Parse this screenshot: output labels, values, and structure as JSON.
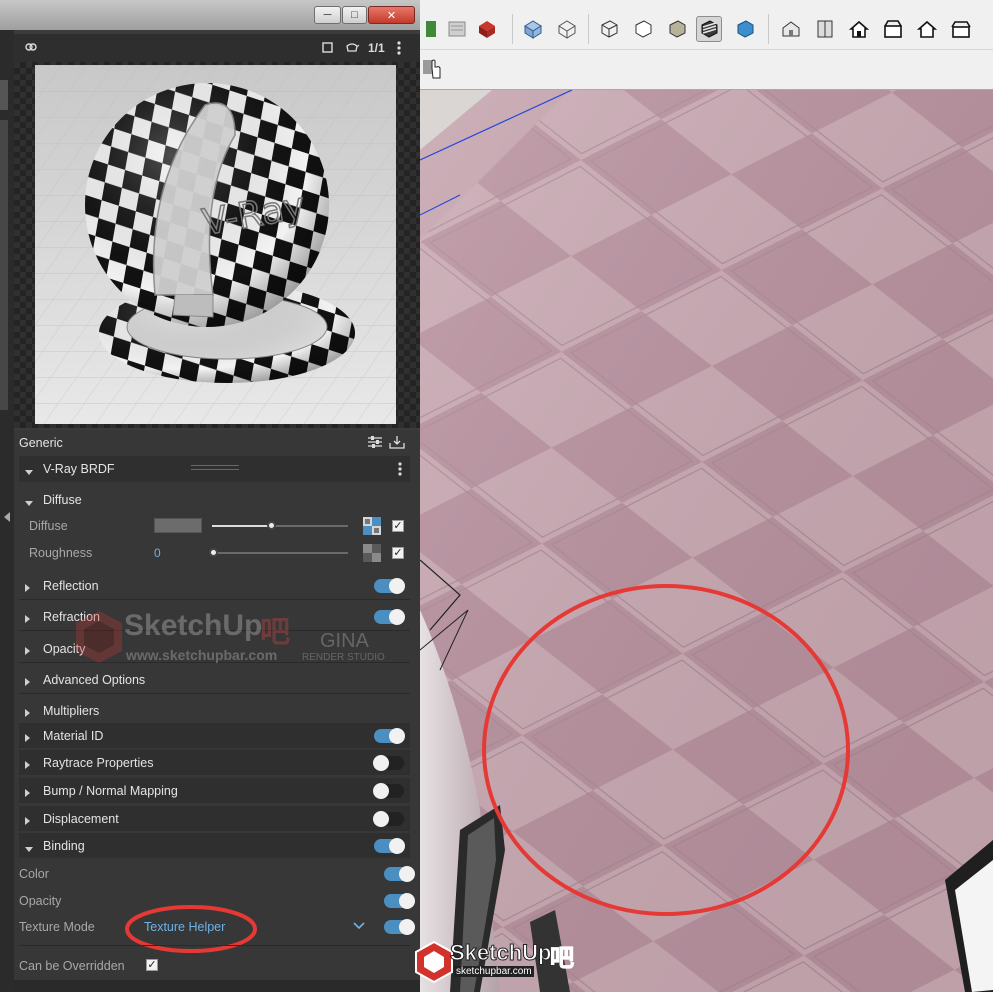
{
  "window": {
    "minimize_glyph": "─",
    "maximize_glyph": "□",
    "close_glyph": "✕"
  },
  "preview": {
    "icons": [
      "link-icon",
      "stop-icon",
      "teapot-icon",
      "aspect-icon",
      "more-icon"
    ],
    "aspect_label": "1/1",
    "ball_logo_text": "V-Ray"
  },
  "material": {
    "header_label": "Generic",
    "brdf_label": "V-Ray BRDF",
    "diffuse_section": "Diffuse",
    "diffuse_label": "Diffuse",
    "diffuse_color": "#6c6c6c",
    "diffuse_amount": 0.45,
    "roughness_label": "Roughness",
    "roughness_value": "0",
    "roughness_amount": 0.0
  },
  "sections": [
    {
      "label": "Reflection",
      "toggle": "on"
    },
    {
      "label": "Refraction",
      "toggle": "on"
    },
    {
      "label": "Opacity",
      "toggle": null
    },
    {
      "label": "Advanced Options",
      "toggle": null
    },
    {
      "label": "Multipliers",
      "toggle": null
    },
    {
      "label": "Material ID",
      "toggle": "on"
    },
    {
      "label": "Raytrace Properties",
      "toggle": "off"
    },
    {
      "label": "Bump / Normal Mapping",
      "toggle": "off"
    },
    {
      "label": "Displacement",
      "toggle": "off"
    },
    {
      "label": "Binding",
      "toggle": "on"
    }
  ],
  "binding": {
    "color_label": "Color",
    "opacity_label": "Opacity",
    "texture_mode_label": "Texture Mode",
    "texture_mode_value": "Texture Helper",
    "override_label": "Can be Overridden",
    "override_checked": "✓"
  },
  "watermark": {
    "brand": "SketchUp",
    "brand_suffix": "吧",
    "url": "www.sketchupbar.com",
    "studio": "GINA",
    "studio_sub": "RENDER STUDIO",
    "bottom_url": "sketchupbar.com"
  },
  "colors": {
    "accent": "#4b8fc2",
    "panel_bg": "#373737",
    "floor_tint": "#c7a7b0",
    "annotation_red": "#e53935"
  }
}
